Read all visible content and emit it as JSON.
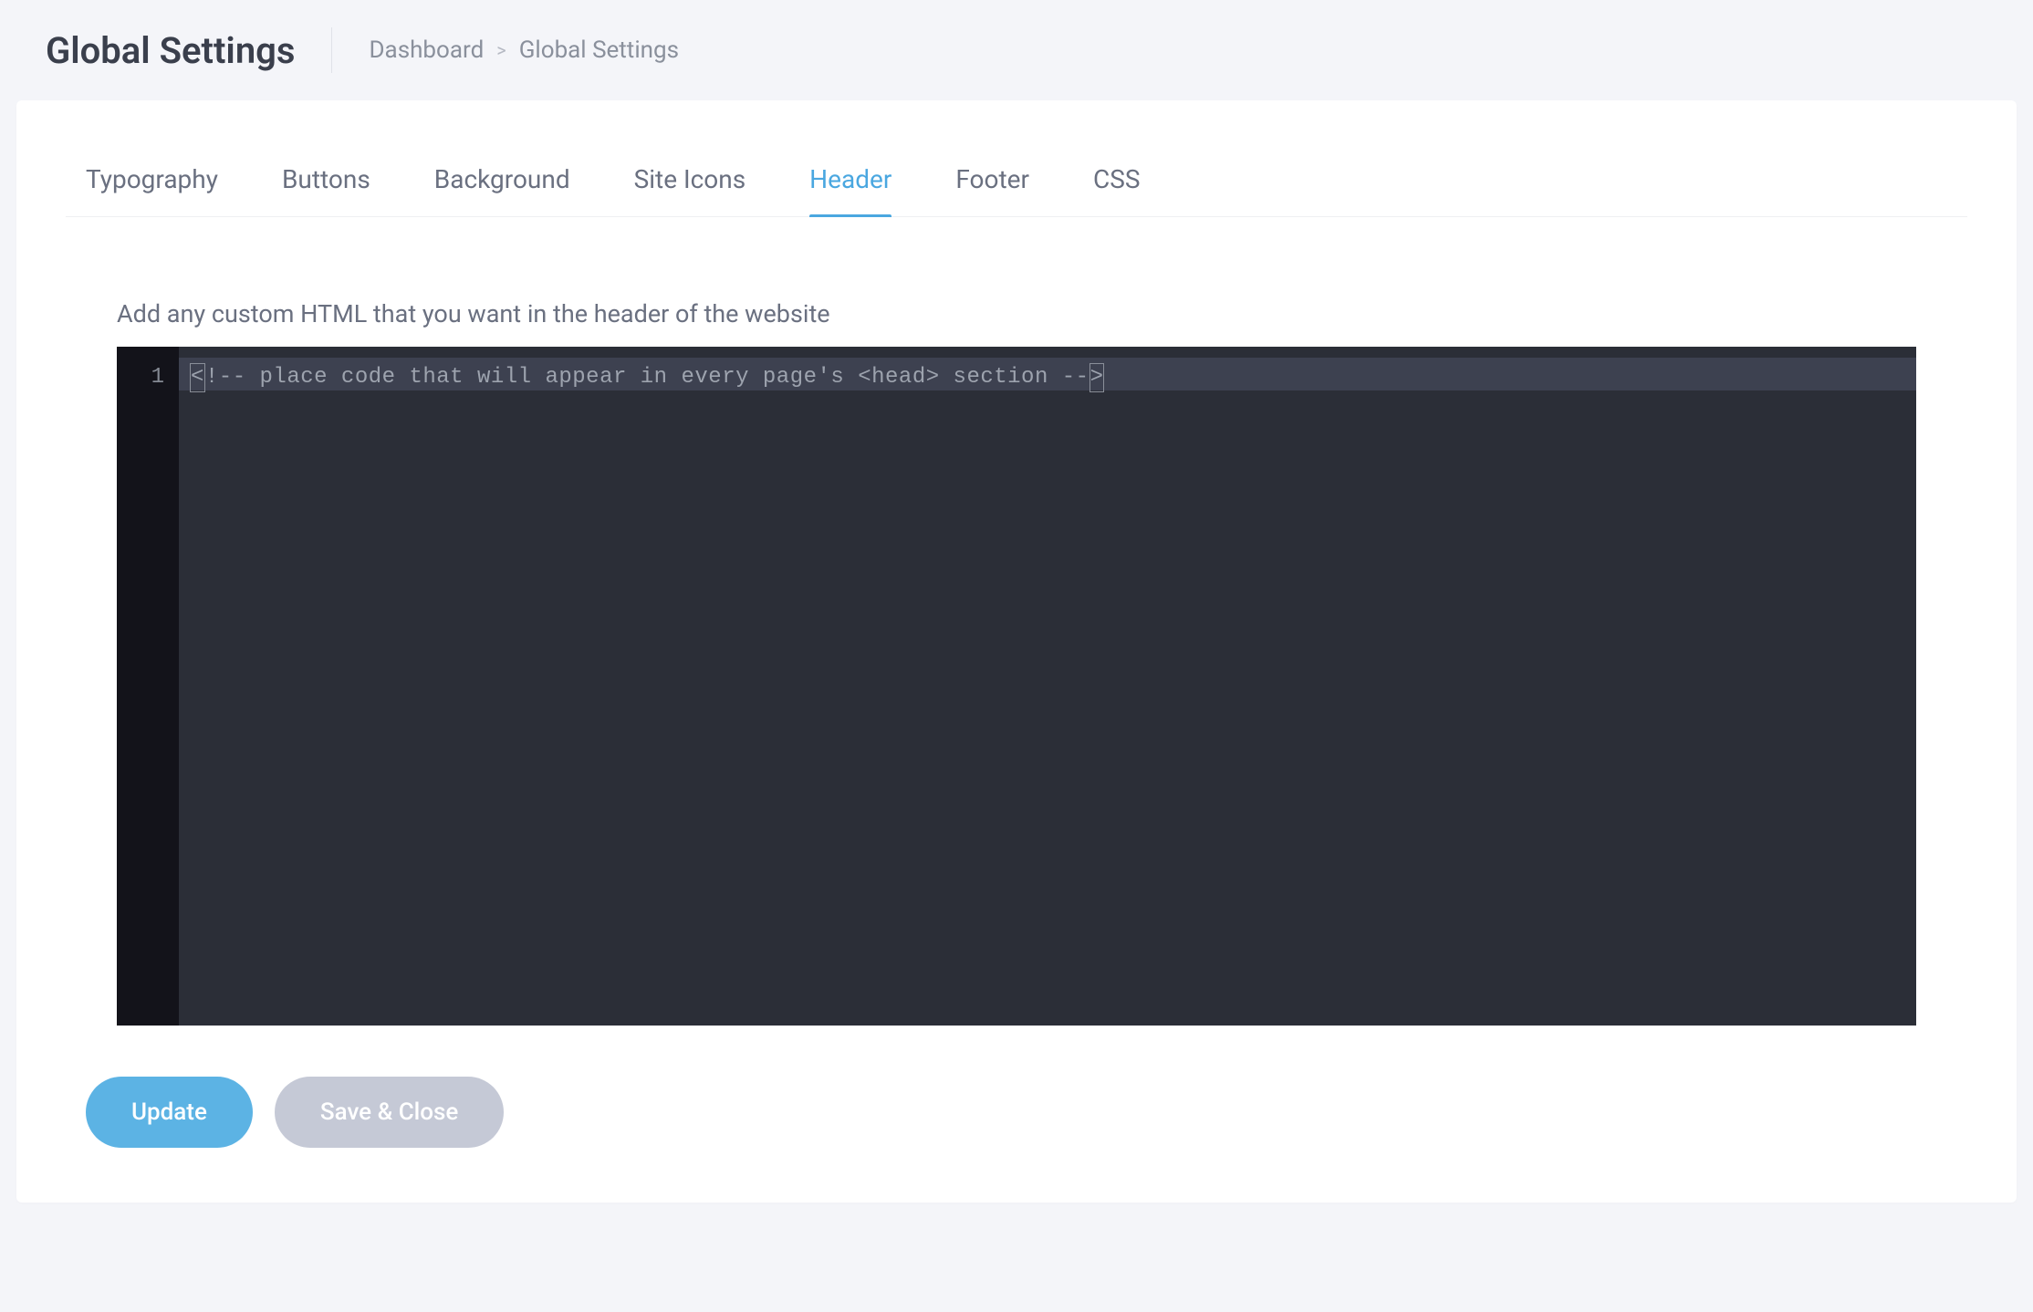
{
  "page": {
    "title": "Global Settings"
  },
  "breadcrumb": {
    "items": [
      "Dashboard",
      "Global Settings"
    ],
    "separator": ">"
  },
  "tabs": [
    {
      "id": "typography",
      "label": "Typography",
      "active": false
    },
    {
      "id": "buttons",
      "label": "Buttons",
      "active": false
    },
    {
      "id": "background",
      "label": "Background",
      "active": false
    },
    {
      "id": "site-icons",
      "label": "Site Icons",
      "active": false
    },
    {
      "id": "header",
      "label": "Header",
      "active": true
    },
    {
      "id": "footer",
      "label": "Footer",
      "active": false
    },
    {
      "id": "css",
      "label": "CSS",
      "active": false
    }
  ],
  "form": {
    "header_html_label": "Add any custom HTML that you want in the header of the website",
    "editor": {
      "lines": [
        {
          "number": "1",
          "text": "<!-- place code that will appear in every page's <head> section -->"
        }
      ]
    }
  },
  "actions": {
    "update_label": "Update",
    "save_close_label": "Save & Close"
  },
  "colors": {
    "accent": "#5cb3e4",
    "page_bg": "#f4f5f9",
    "card_bg": "#ffffff",
    "editor_bg": "#2b2e37",
    "gutter_bg": "#13131a"
  }
}
